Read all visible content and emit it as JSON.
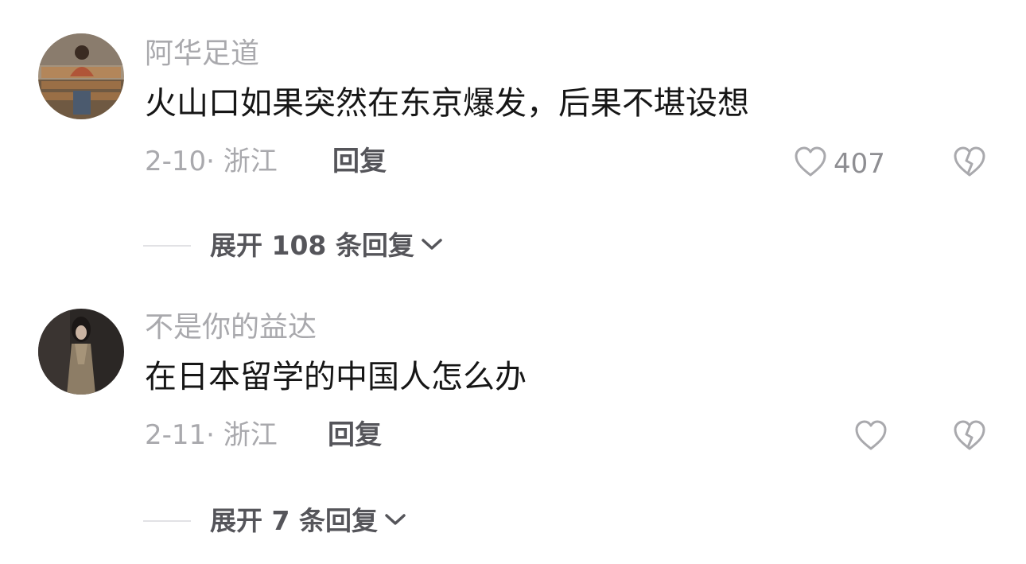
{
  "comments": [
    {
      "username": "阿华足道",
      "text": "火山口如果突然在东京爆发，后果不堪设想",
      "meta": "2-10· 浙江",
      "reply_label": "回复",
      "likes": "407",
      "expand_label": "展开 108 条回复"
    },
    {
      "username": "不是你的益达",
      "text": "在日本留学的中国人怎么办",
      "meta": "2-11· 浙江",
      "reply_label": "回复",
      "likes": "",
      "expand_label": "展开 7 条回复"
    }
  ],
  "icons": {
    "like": "heart-outline-icon",
    "dislike": "broken-heart-icon",
    "expand": "chevron-down-icon"
  },
  "colors": {
    "username": "#a9a9ad",
    "text": "#161616",
    "meta": "#a9a9ad",
    "action": "#55555a"
  }
}
